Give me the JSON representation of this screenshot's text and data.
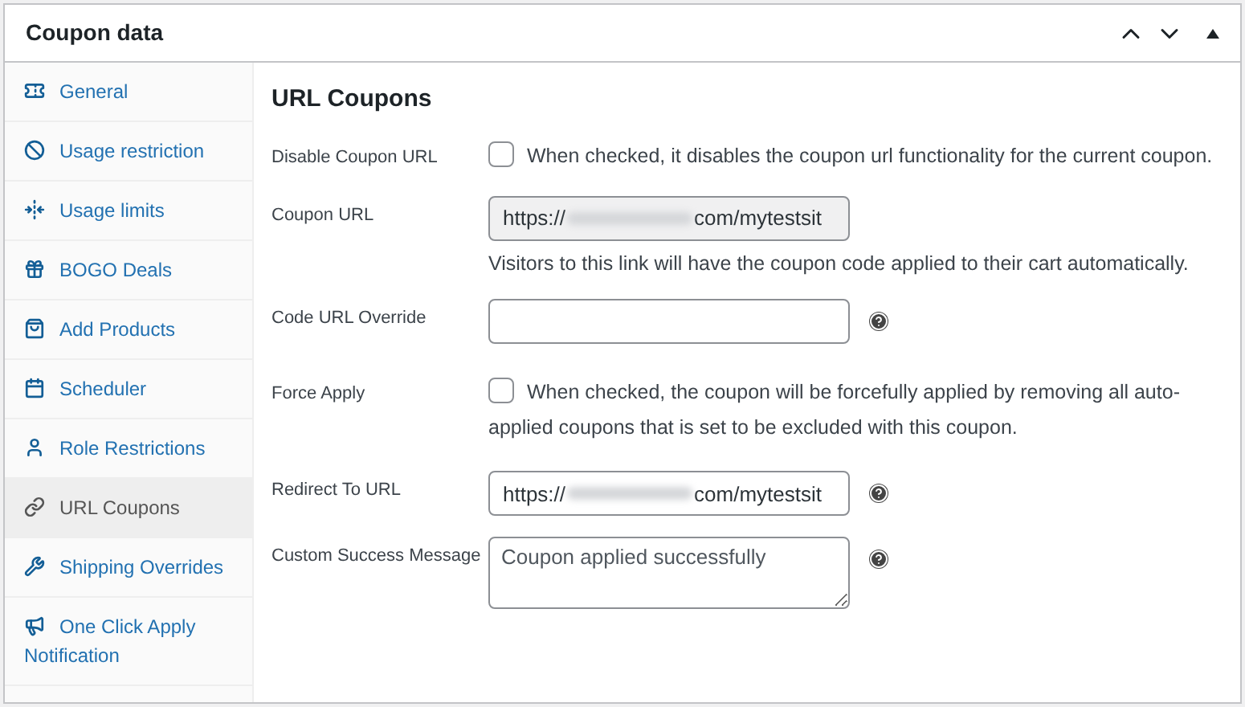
{
  "panel": {
    "title": "Coupon data"
  },
  "tabs": [
    {
      "label": "General",
      "selected": false
    },
    {
      "label": "Usage restriction",
      "selected": false
    },
    {
      "label": "Usage limits",
      "selected": false
    },
    {
      "label": "BOGO Deals",
      "selected": false
    },
    {
      "label": "Add Products",
      "selected": false
    },
    {
      "label": "Scheduler",
      "selected": false
    },
    {
      "label": "Role Restrictions",
      "selected": false
    },
    {
      "label": "URL Coupons",
      "selected": true
    },
    {
      "label": "Shipping Overrides",
      "selected": false
    },
    {
      "label": "One Click Apply Notification",
      "selected": false
    }
  ],
  "section": {
    "heading": "URL Coupons"
  },
  "fields": [
    {
      "kind": "checkbox",
      "label": "Disable Coupon URL",
      "checked": false,
      "description": "When checked, it disables the coupon url functionality for the current coupon."
    },
    {
      "kind": "url",
      "label": "Coupon URL",
      "value_start": "https://",
      "value_end": "com/mytestsit",
      "readonly": true,
      "help": false,
      "note": "Visitors to this link will have the coupon code applied to their cart automatically."
    },
    {
      "kind": "text",
      "label": "Code URL Override",
      "help": true
    },
    {
      "kind": "checkbox",
      "label": "Force Apply",
      "checked": false,
      "description": "When checked, the coupon will be forcefully applied by removing all auto-applied coupons that is set to be excluded with this coupon."
    },
    {
      "kind": "url",
      "label": "Redirect To URL",
      "value_start": "https://",
      "value_end": "com/mytestsit",
      "readonly": false,
      "help": true
    },
    {
      "kind": "textarea",
      "label": "Custom Success Message",
      "placeholder": "Coupon applied successfully",
      "help": true
    }
  ]
}
